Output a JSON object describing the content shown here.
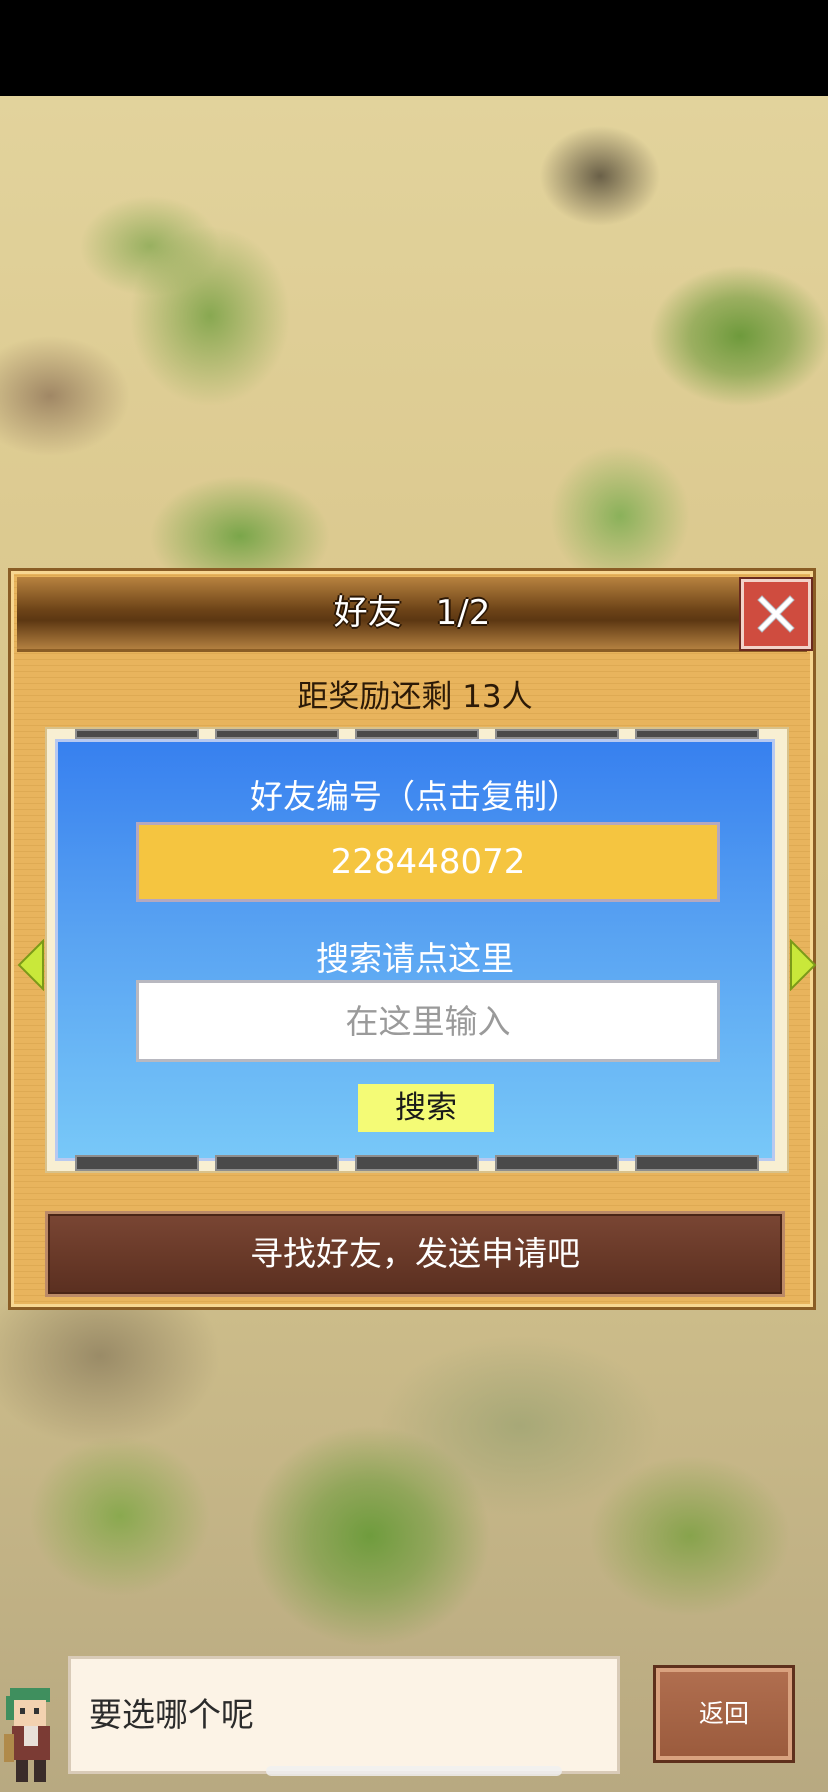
{
  "dialog": {
    "title": "好友　1/2",
    "reward_text": "距奖励还剩 13人",
    "friend_code_label": "好友编号（点击复制）",
    "friend_code_value": "228448072",
    "search_label": "搜索请点这里",
    "search_placeholder": "在这里输入",
    "search_button_label": "搜索",
    "action_label": "寻找好友，发送申请吧",
    "icons": {
      "close": "close-icon",
      "prev": "arrow-left-icon",
      "next": "arrow-right-icon"
    },
    "colors": {
      "code_field": "#f5c540",
      "search_button": "#f4fb76",
      "close_button": "#cf4c3f",
      "arrow": "#c9e83a"
    }
  },
  "bottom": {
    "speech_text": "要选哪个呢",
    "back_button_label": "返回"
  }
}
